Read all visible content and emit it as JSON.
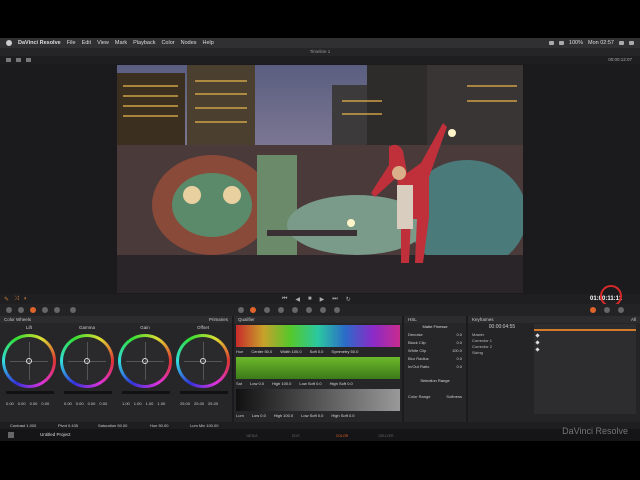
{
  "menubar": {
    "app_name": "DaVinci Resolve",
    "items": [
      "File",
      "Edit",
      "View",
      "Mark",
      "Playback",
      "Color",
      "Nodes",
      "Help"
    ],
    "status": "100%",
    "clock": "Mon 02:57"
  },
  "window": {
    "title": "Timeline 1"
  },
  "viewer": {
    "timecode": "00:00:12:07"
  },
  "transport": {
    "timecode": "01:00:11:11",
    "buttons": [
      "⏮",
      "◀",
      "■",
      "▶",
      "⏭",
      "↻"
    ]
  },
  "color_wheels": {
    "title": "Color Wheels",
    "mode": "Primaries",
    "wheels": [
      {
        "label": "Lift",
        "values": [
          "0.00",
          "0.00",
          "0.00",
          "0.00"
        ]
      },
      {
        "label": "Gamma",
        "values": [
          "0.00",
          "0.00",
          "0.00",
          "0.00"
        ]
      },
      {
        "label": "Gain",
        "values": [
          "1.00",
          "1.00",
          "1.00",
          "1.00"
        ]
      },
      {
        "label": "Offset",
        "values": [
          "25.00",
          "25.00",
          "25.00"
        ]
      }
    ]
  },
  "qualifier": {
    "title": "Qualifier",
    "hue_row": {
      "label": "Hue",
      "center": "Center 50.0",
      "width": "Width 100.0",
      "soft": "Soft 0.0",
      "symmetry": "Symmetry 50.0"
    },
    "sat_row": {
      "label": "Sat",
      "low": "Low 0.0",
      "high": "High 100.0",
      "low_soft": "Low Soft 0.0",
      "high_soft": "High Soft 0.0"
    },
    "lum_row": {
      "label": "Lum",
      "low": "Low 0.0",
      "high": "High 100.0",
      "low_soft": "Low Soft 0.0",
      "high_soft": "High Soft 0.0"
    }
  },
  "hsl": {
    "title": "HSL",
    "section": "Matte Finesse",
    "rows": [
      {
        "label": "Denoise",
        "value": "0.0"
      },
      {
        "label": "Black Clip",
        "value": "0.0"
      },
      {
        "label": "White Clip",
        "value": "100.0"
      },
      {
        "label": "Blur Radius",
        "value": "0.0"
      },
      {
        "label": "In/Out Ratio",
        "value": "0.0"
      }
    ],
    "range_title": "Selection Range",
    "range_labels": [
      "Color Range",
      "Softness"
    ]
  },
  "keyframes": {
    "title": "Keyframes",
    "filter": "All",
    "timecode": "00:00:04:55",
    "tracks": [
      "Master",
      "Corrector 1",
      "Corrector 2",
      "Sizing"
    ]
  },
  "bottom_params": {
    "contrast": "Contrast 1.000",
    "pivot": "Pivot 0.435",
    "saturation": "Saturation 50.00",
    "hue": "Hue 50.00",
    "lum_mix": "Lum Mix 100.00"
  },
  "pagebar": {
    "project": "Untitled Project",
    "tabs": [
      "MEDIA",
      "EDIT",
      "COLOR",
      "DELIVER"
    ],
    "active_tab": "COLOR",
    "brand": "DaVinci Resolve"
  },
  "accent_color": "#e0632a"
}
